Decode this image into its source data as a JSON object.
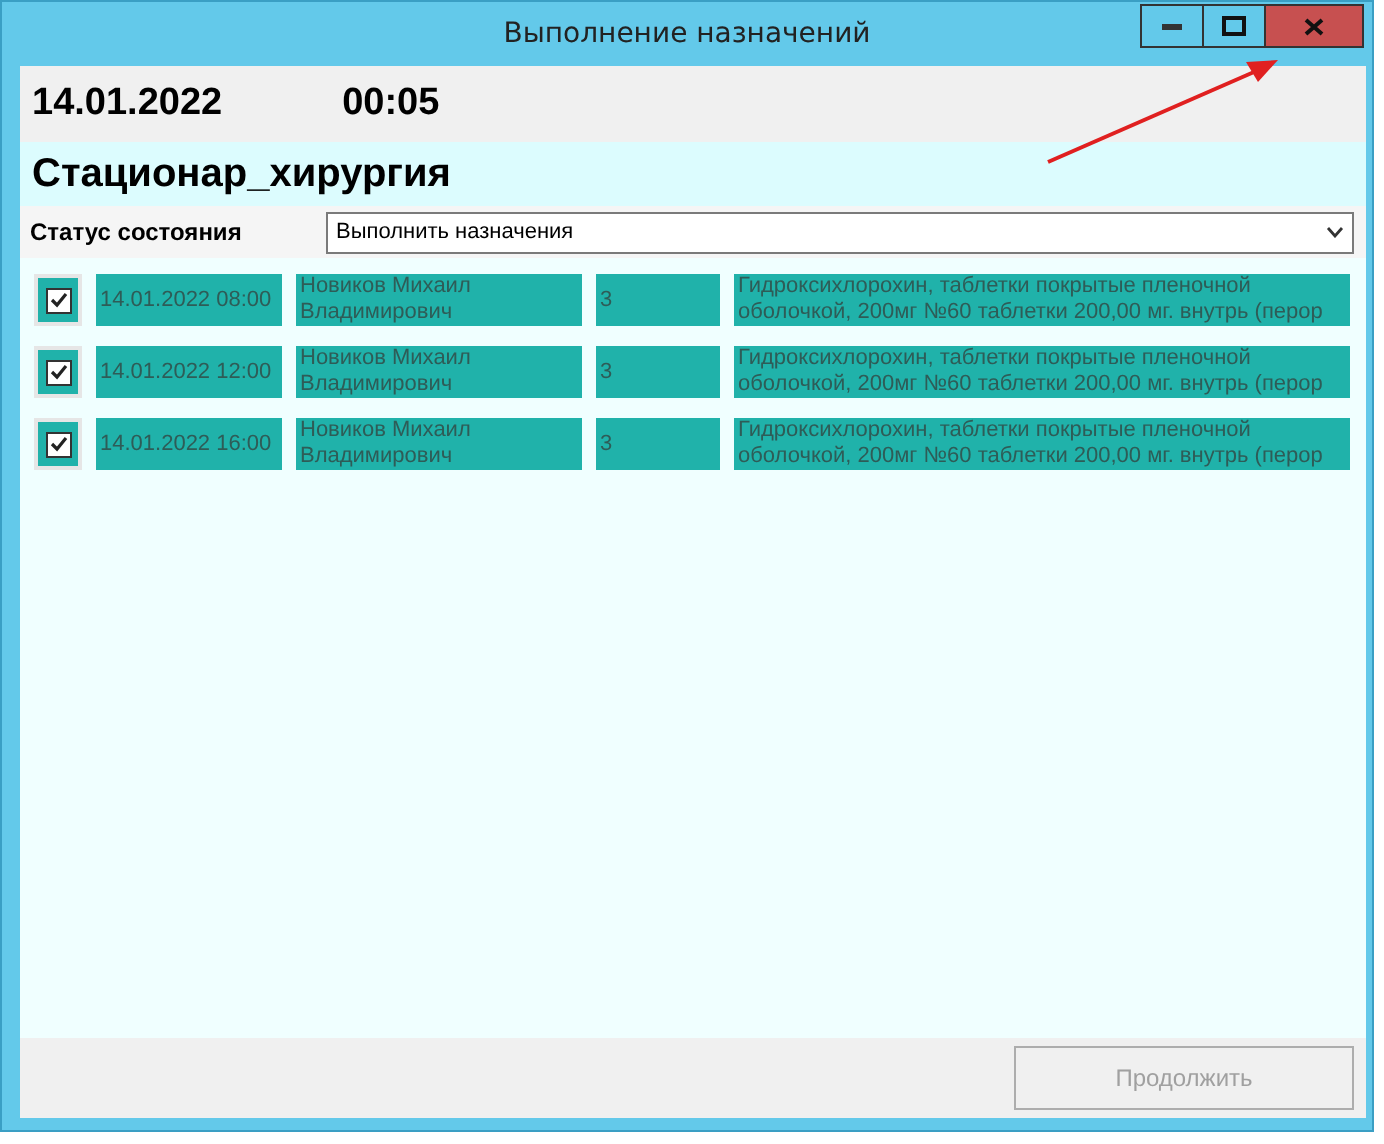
{
  "window": {
    "title": "Выполнение назначений"
  },
  "header": {
    "date": "14.01.2022",
    "time": "00:05"
  },
  "department": "Стационар_хирургия",
  "status": {
    "label": "Статус состояния",
    "value": "Выполнить назначения"
  },
  "rows": [
    {
      "checked": true,
      "datetime": "14.01.2022 08:00",
      "patient": "Новиков Михаил Владимирович",
      "quantity": "3",
      "drug": "Гидроксихлорохин, таблетки покрытые пленочной\nоболочкой, 200мг №60 таблетки 200,00 мг. внутрь (перор"
    },
    {
      "checked": true,
      "datetime": "14.01.2022 12:00",
      "patient": "Новиков Михаил Владимирович",
      "quantity": "3",
      "drug": "Гидроксихлорохин, таблетки покрытые пленочной\nоболочкой, 200мг №60 таблетки 200,00 мг. внутрь (перор"
    },
    {
      "checked": true,
      "datetime": "14.01.2022 16:00",
      "patient": "Новиков Михаил Владимирович",
      "quantity": "3",
      "drug": "Гидроксихлорохин, таблетки покрытые пленочной\nоболочкой, 200мг №60 таблетки 200,00 мг. внутрь (перор"
    }
  ],
  "continue_button": {
    "label": "Продолжить",
    "disabled": true
  }
}
